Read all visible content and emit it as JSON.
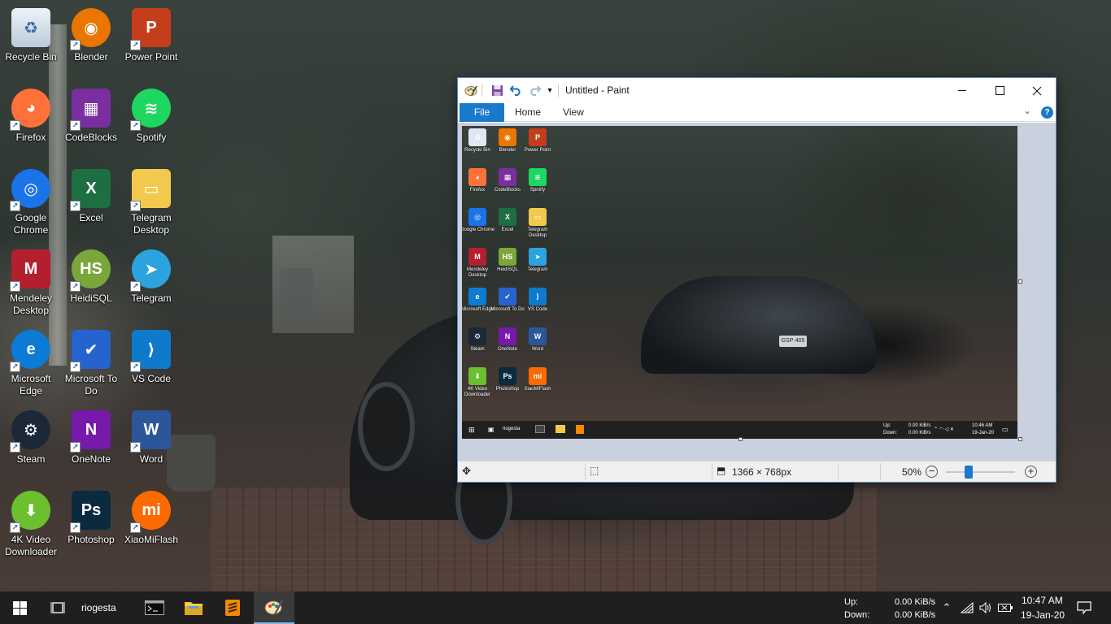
{
  "desktop": {
    "icons": [
      {
        "label": "Recycle Bin",
        "icon": "recycle-bin-icon",
        "color": "#dfe7f0",
        "glyph": "♻"
      },
      {
        "label": "Blender",
        "icon": "blender-icon",
        "color": "#ea7600",
        "glyph": "◉"
      },
      {
        "label": "Power Point",
        "icon": "powerpoint-icon",
        "color": "#c43e1c",
        "glyph": "P"
      },
      {
        "label": "Firefox",
        "icon": "firefox-icon",
        "color": "#ff7139",
        "glyph": "◕"
      },
      {
        "label": "CodeBlocks",
        "icon": "codeblocks-icon",
        "color": "#7a2ea0",
        "glyph": "▦"
      },
      {
        "label": "Spotify",
        "icon": "spotify-icon",
        "color": "#1ed760",
        "glyph": "≋"
      },
      {
        "label": "Google Chrome",
        "icon": "chrome-icon",
        "color": "#1a73e8",
        "glyph": "◎"
      },
      {
        "label": "Excel",
        "icon": "excel-icon",
        "color": "#1d6f42",
        "glyph": "X"
      },
      {
        "label": "Telegram Desktop",
        "icon": "folder-icon",
        "color": "#f2c94c",
        "glyph": "▭"
      },
      {
        "label": "Mendeley Desktop",
        "icon": "mendeley-icon",
        "color": "#b31f2e",
        "glyph": "M"
      },
      {
        "label": "HeidiSQL",
        "icon": "heidisql-icon",
        "color": "#7aa63a",
        "glyph": "HS"
      },
      {
        "label": "Telegram",
        "icon": "telegram-icon",
        "color": "#2aa3df",
        "glyph": "➤"
      },
      {
        "label": "Microsoft Edge",
        "icon": "edge-icon",
        "color": "#0c7bd6",
        "glyph": "e"
      },
      {
        "label": "Microsoft To Do",
        "icon": "todo-icon",
        "color": "#2564cf",
        "glyph": "✔"
      },
      {
        "label": "VS Code",
        "icon": "vscode-icon",
        "color": "#0e7acc",
        "glyph": "⟩"
      },
      {
        "label": "Steam",
        "icon": "steam-icon",
        "color": "#1b2838",
        "glyph": "⚙"
      },
      {
        "label": "OneNote",
        "icon": "onenote-icon",
        "color": "#7719aa",
        "glyph": "N"
      },
      {
        "label": "Word",
        "icon": "word-icon",
        "color": "#2b579a",
        "glyph": "W"
      },
      {
        "label": "4K Video Downloader",
        "icon": "video-downloader-icon",
        "color": "#6cbf2e",
        "glyph": "⬇"
      },
      {
        "label": "Photoshop",
        "icon": "photoshop-icon",
        "color": "#0b2a3f",
        "glyph": "Ps"
      },
      {
        "label": "XiaoMiFlash",
        "icon": "xiaomiflash-icon",
        "color": "#ff6a00",
        "glyph": "mi"
      }
    ]
  },
  "paint": {
    "title": "Untitled - Paint",
    "tabs": {
      "file": "File",
      "home": "Home",
      "view": "View"
    },
    "status": {
      "dimensions": "1366 × 768px",
      "zoom": "50%",
      "zoom_fraction": 0.5
    },
    "canvas_mini": {
      "icons": [
        "Recycle Bin",
        "Blender",
        "Power Point",
        "Firefox",
        "CodeBlocks",
        "Spotify",
        "Google Chrome",
        "Excel",
        "Telegram Desktop",
        "Mendeley Desktop",
        "HeidiSQL",
        "Telegram",
        "Microsoft Edge",
        "Microsoft To Do",
        "VS Code",
        "Steam",
        "OneNote",
        "Word",
        "4K Video Downloader",
        "Photoshop",
        "XiaoMiFlash"
      ],
      "taskbar_user": "riogesta",
      "net_up": "Up:",
      "net_up_val": "0.00 KiB/s",
      "net_down": "Down:",
      "net_down_val": "0.00 KiB/s",
      "time": "10:46 AM",
      "date": "19-Jan-20"
    }
  },
  "taskbar": {
    "user": "riogesta",
    "net_up_label": "Up:",
    "net_up_value": "0.00 KiB/s",
    "net_down_label": "Down:",
    "net_down_value": "0.00 KiB/s",
    "time": "10:47 AM",
    "date": "19-Jan-20"
  }
}
